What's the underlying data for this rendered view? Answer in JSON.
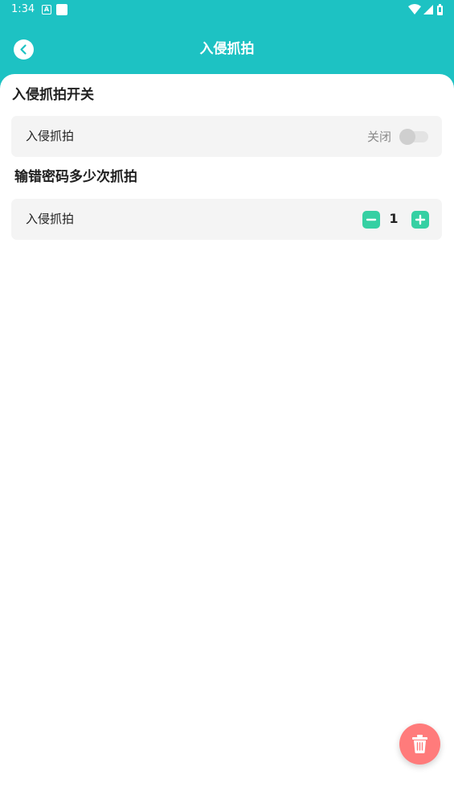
{
  "status_bar": {
    "time": "1:34",
    "notification_icon_a": "A",
    "icons": [
      "wifi-icon",
      "signal-icon",
      "battery-icon"
    ]
  },
  "app_bar": {
    "title": "入侵抓拍",
    "back_icon": "back-arrow-icon"
  },
  "sections": {
    "switch_section": {
      "title": "入侵抓拍开关",
      "item_label": "入侵抓拍",
      "switch_status": "关闭",
      "switch_on": false
    },
    "count_section": {
      "title": "输错密码多少次抓拍",
      "item_label": "入侵抓拍",
      "count": "1"
    }
  },
  "fab": {
    "icon": "trash-icon"
  },
  "colors": {
    "primary": "#1dc2c3",
    "accent_green": "#35d0a3",
    "fab_red": "#ff7b7b",
    "card_bg": "#f4f4f4"
  }
}
